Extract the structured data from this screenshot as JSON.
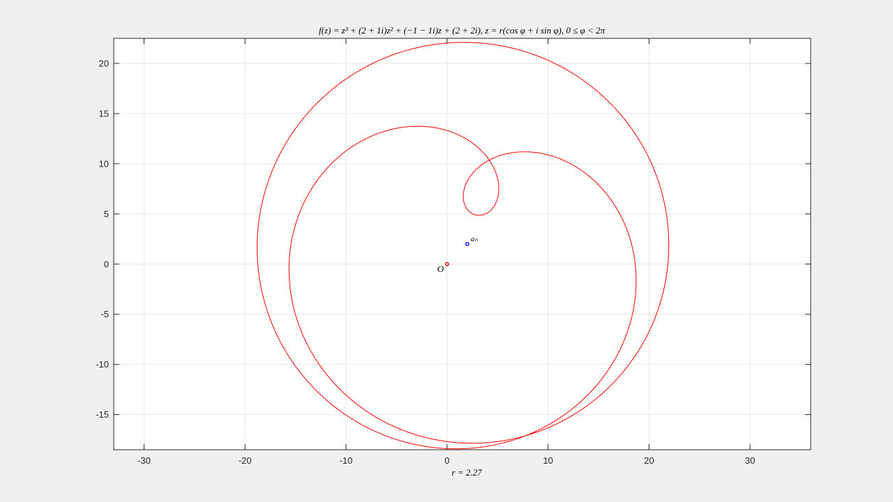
{
  "chart_data": {
    "type": "line",
    "title": "f(z) = z³ + (2 + 1i)z² + (−1 − 1i)z + (2 + 2i), z = r(cos φ + i sin φ), 0 ≤ φ < 2π",
    "xlabel": "r = 2.27",
    "ylabel": "",
    "xlim": [
      -33,
      36
    ],
    "ylim": [
      -18.5,
      22.5
    ],
    "grid": true,
    "x_ticks": [
      -30,
      -20,
      -10,
      0,
      10,
      20,
      30
    ],
    "x_tick_labels": [
      "-30",
      "-20",
      "-10",
      "0",
      "10",
      "20",
      "30"
    ],
    "y_ticks": [
      -15,
      -10,
      -5,
      0,
      5,
      10,
      15,
      20
    ],
    "y_tick_labels": [
      "-15",
      "-10",
      "-5",
      "0",
      "5",
      "10",
      "15",
      "20"
    ],
    "curve": {
      "function": "f(z) = z^3 + (2+1i) z^2 + (-1-1i) z + (2+2i)",
      "coefficients": [
        [
          1,
          0
        ],
        [
          2,
          1
        ],
        [
          -1,
          -1
        ],
        [
          2,
          2
        ]
      ],
      "r": 2.27,
      "phi_range": [
        0,
        6.283185307179586
      ],
      "color": "#ff0000"
    },
    "points": [
      {
        "label": "O",
        "x": 0,
        "y": 0,
        "color": "#ff0000"
      },
      {
        "label": "aₙ",
        "x": 2,
        "y": 2,
        "color": "#0000ff"
      }
    ]
  }
}
